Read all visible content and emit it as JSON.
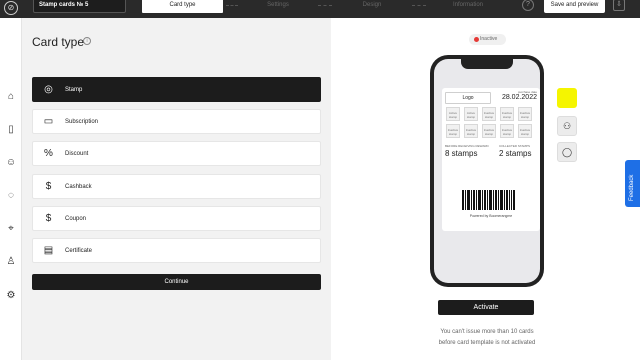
{
  "topbar": {
    "project_name": "Stamp cards № 5",
    "steps": [
      "Card type",
      "Settings",
      "Design",
      "Information"
    ],
    "help_icon": "question-icon",
    "save_label": "Save and preview",
    "download_icon": "download-icon"
  },
  "nav": [
    "home-icon",
    "card-icon",
    "users-icon",
    "chat-icon",
    "location-icon",
    "user-icon",
    "gear-icon"
  ],
  "panel": {
    "title": "Card type",
    "options": [
      {
        "label": "Stamp",
        "icon": "stamp-icon",
        "selected": true
      },
      {
        "label": "Subscription",
        "icon": "ticket-icon",
        "selected": false
      },
      {
        "label": "Discount",
        "icon": "percent-icon",
        "selected": false
      },
      {
        "label": "Cashback",
        "icon": "dollar-icon",
        "selected": false
      },
      {
        "label": "Coupon",
        "icon": "coupon-icon",
        "selected": false
      },
      {
        "label": "Certificate",
        "icon": "certificate-icon",
        "selected": false
      }
    ],
    "continue_label": "Continue"
  },
  "preview": {
    "status": "Inactive",
    "status_color": "#e53935",
    "card": {
      "logo": "Logo",
      "date_label": "purchase date",
      "date": "28.02.2022",
      "stamps": [
        "Active stamp",
        "Active stamp",
        "Inactive stamp",
        "Inactive stamp",
        "Inactive stamp",
        "Inactive stamp",
        "Inactive stamp",
        "Inactive stamp",
        "Inactive stamp",
        "Inactive stamp"
      ],
      "reward_label": "BEFORE RECEIVING REWARD",
      "reward_value": "8 stamps",
      "collected_label": "COLLECTED STAMPS",
      "collected_value": "2 stamps",
      "powered": "Powered by Boomerangme"
    },
    "activate_label": "Activate",
    "note_line1": "You can't issue more than 10 cards",
    "note_line2": "before card template is not activated"
  },
  "platforms": [
    "apple-icon",
    "android-icon",
    "chat-icon"
  ],
  "accent_color": "#f5f500",
  "feedback_label": "Feedback"
}
